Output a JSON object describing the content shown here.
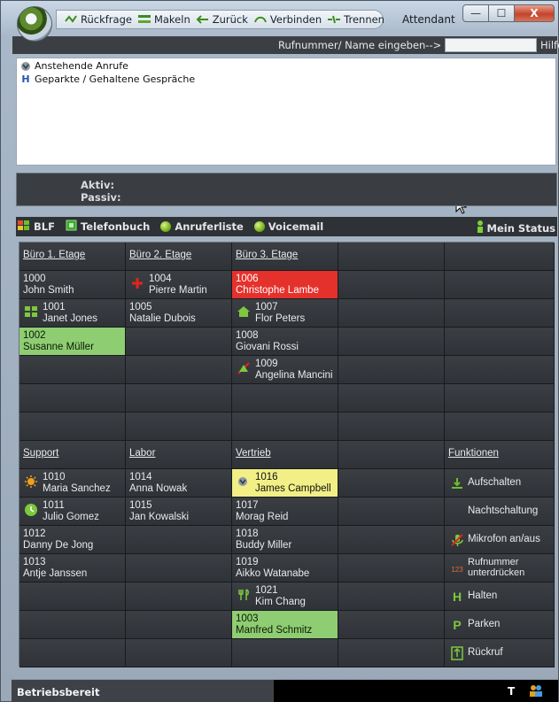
{
  "window": {
    "title": "Attendant",
    "minimize_label": "—",
    "maximize_label": "☐",
    "close_label": "X"
  },
  "quick_access": {
    "rueckfrage": "Rückfrage",
    "makeln": "Makeln",
    "zurueck": "Zurück",
    "verbinden": "Verbinden",
    "trennen": "Trennen"
  },
  "number_bar": {
    "label": "Rufnummer/ Name eingeben-->",
    "input_value": "",
    "help": "Hilfe"
  },
  "call_list": {
    "items": [
      {
        "label": "Anstehende Anrufe",
        "icon": "pending-calls-icon"
      },
      {
        "label": "Geparkte / Gehaltene Gespräche",
        "icon": "parked-calls-icon"
      }
    ]
  },
  "call_status": {
    "active": "Aktiv:",
    "passive": "Passiv:"
  },
  "toolbar": {
    "blf": "BLF",
    "telefonbuch": "Telefonbuch",
    "anruferliste": "Anruferliste",
    "voicemail": "Voicemail",
    "mein_status": "Mein Status"
  },
  "grid": {
    "headers_top": [
      "Büro 1. Etage",
      "Büro 2. Etage",
      "Büro 3. Etage"
    ],
    "headers_bottom": [
      "Support",
      "Labor",
      "Vertrieb",
      "Funktionen"
    ],
    "b1": [
      {
        "ext": "1000",
        "name": "John Smith"
      },
      {
        "ext": "1001",
        "name": "Janet Jones"
      },
      {
        "ext": "1002",
        "name": "Susanne Müller"
      }
    ],
    "b2": [
      {
        "ext": "1004",
        "name": "Pierre Martin"
      },
      {
        "ext": "1005",
        "name": "Natalie Dubois"
      }
    ],
    "b3": [
      {
        "ext": "1006",
        "name": "Christophe Lambe"
      },
      {
        "ext": "1007",
        "name": "Flor Peters"
      },
      {
        "ext": "1008",
        "name": "Giovani Rossi"
      },
      {
        "ext": "1009",
        "name": "Angelina Mancini"
      }
    ],
    "support": [
      {
        "ext": "1010",
        "name": "Maria Sanchez"
      },
      {
        "ext": "1011",
        "name": "Julio Gomez"
      },
      {
        "ext": "1012",
        "name": "Danny De Jong"
      },
      {
        "ext": "1013",
        "name": "Antje Janssen"
      }
    ],
    "labor": [
      {
        "ext": "1014",
        "name": "Anna Nowak"
      },
      {
        "ext": "1015",
        "name": "Jan Kowalski"
      }
    ],
    "vertrieb": [
      {
        "ext": "1016",
        "name": "James Campbell"
      },
      {
        "ext": "1017",
        "name": "Morag Reid"
      },
      {
        "ext": "1018",
        "name": "Buddy Miller"
      },
      {
        "ext": "1019",
        "name": "Aikko Watanabe"
      },
      {
        "ext": "1021",
        "name": "Kim Chang"
      },
      {
        "ext": "1003",
        "name": "Manfred Schmitz"
      }
    ],
    "functions": {
      "aufschalten": "Aufschalten",
      "nachtschaltung": "Nachtschaltung",
      "mikrofon": "Mikrofon an/aus",
      "rufnummer_1": "Rufnummer",
      "rufnummer_2": "unterdrücken",
      "rufnummer_icon_text": "123",
      "halten": "Halten",
      "parken": "Parken",
      "rueckruf": "Rückruf"
    }
  },
  "statusbar": {
    "text": "Betriebsbereit",
    "indicator": "T"
  },
  "colors": {
    "busy": "#e5312c",
    "free": "#8fcd72",
    "ringing": "#f2ef86",
    "panel": "#3b3f44"
  }
}
